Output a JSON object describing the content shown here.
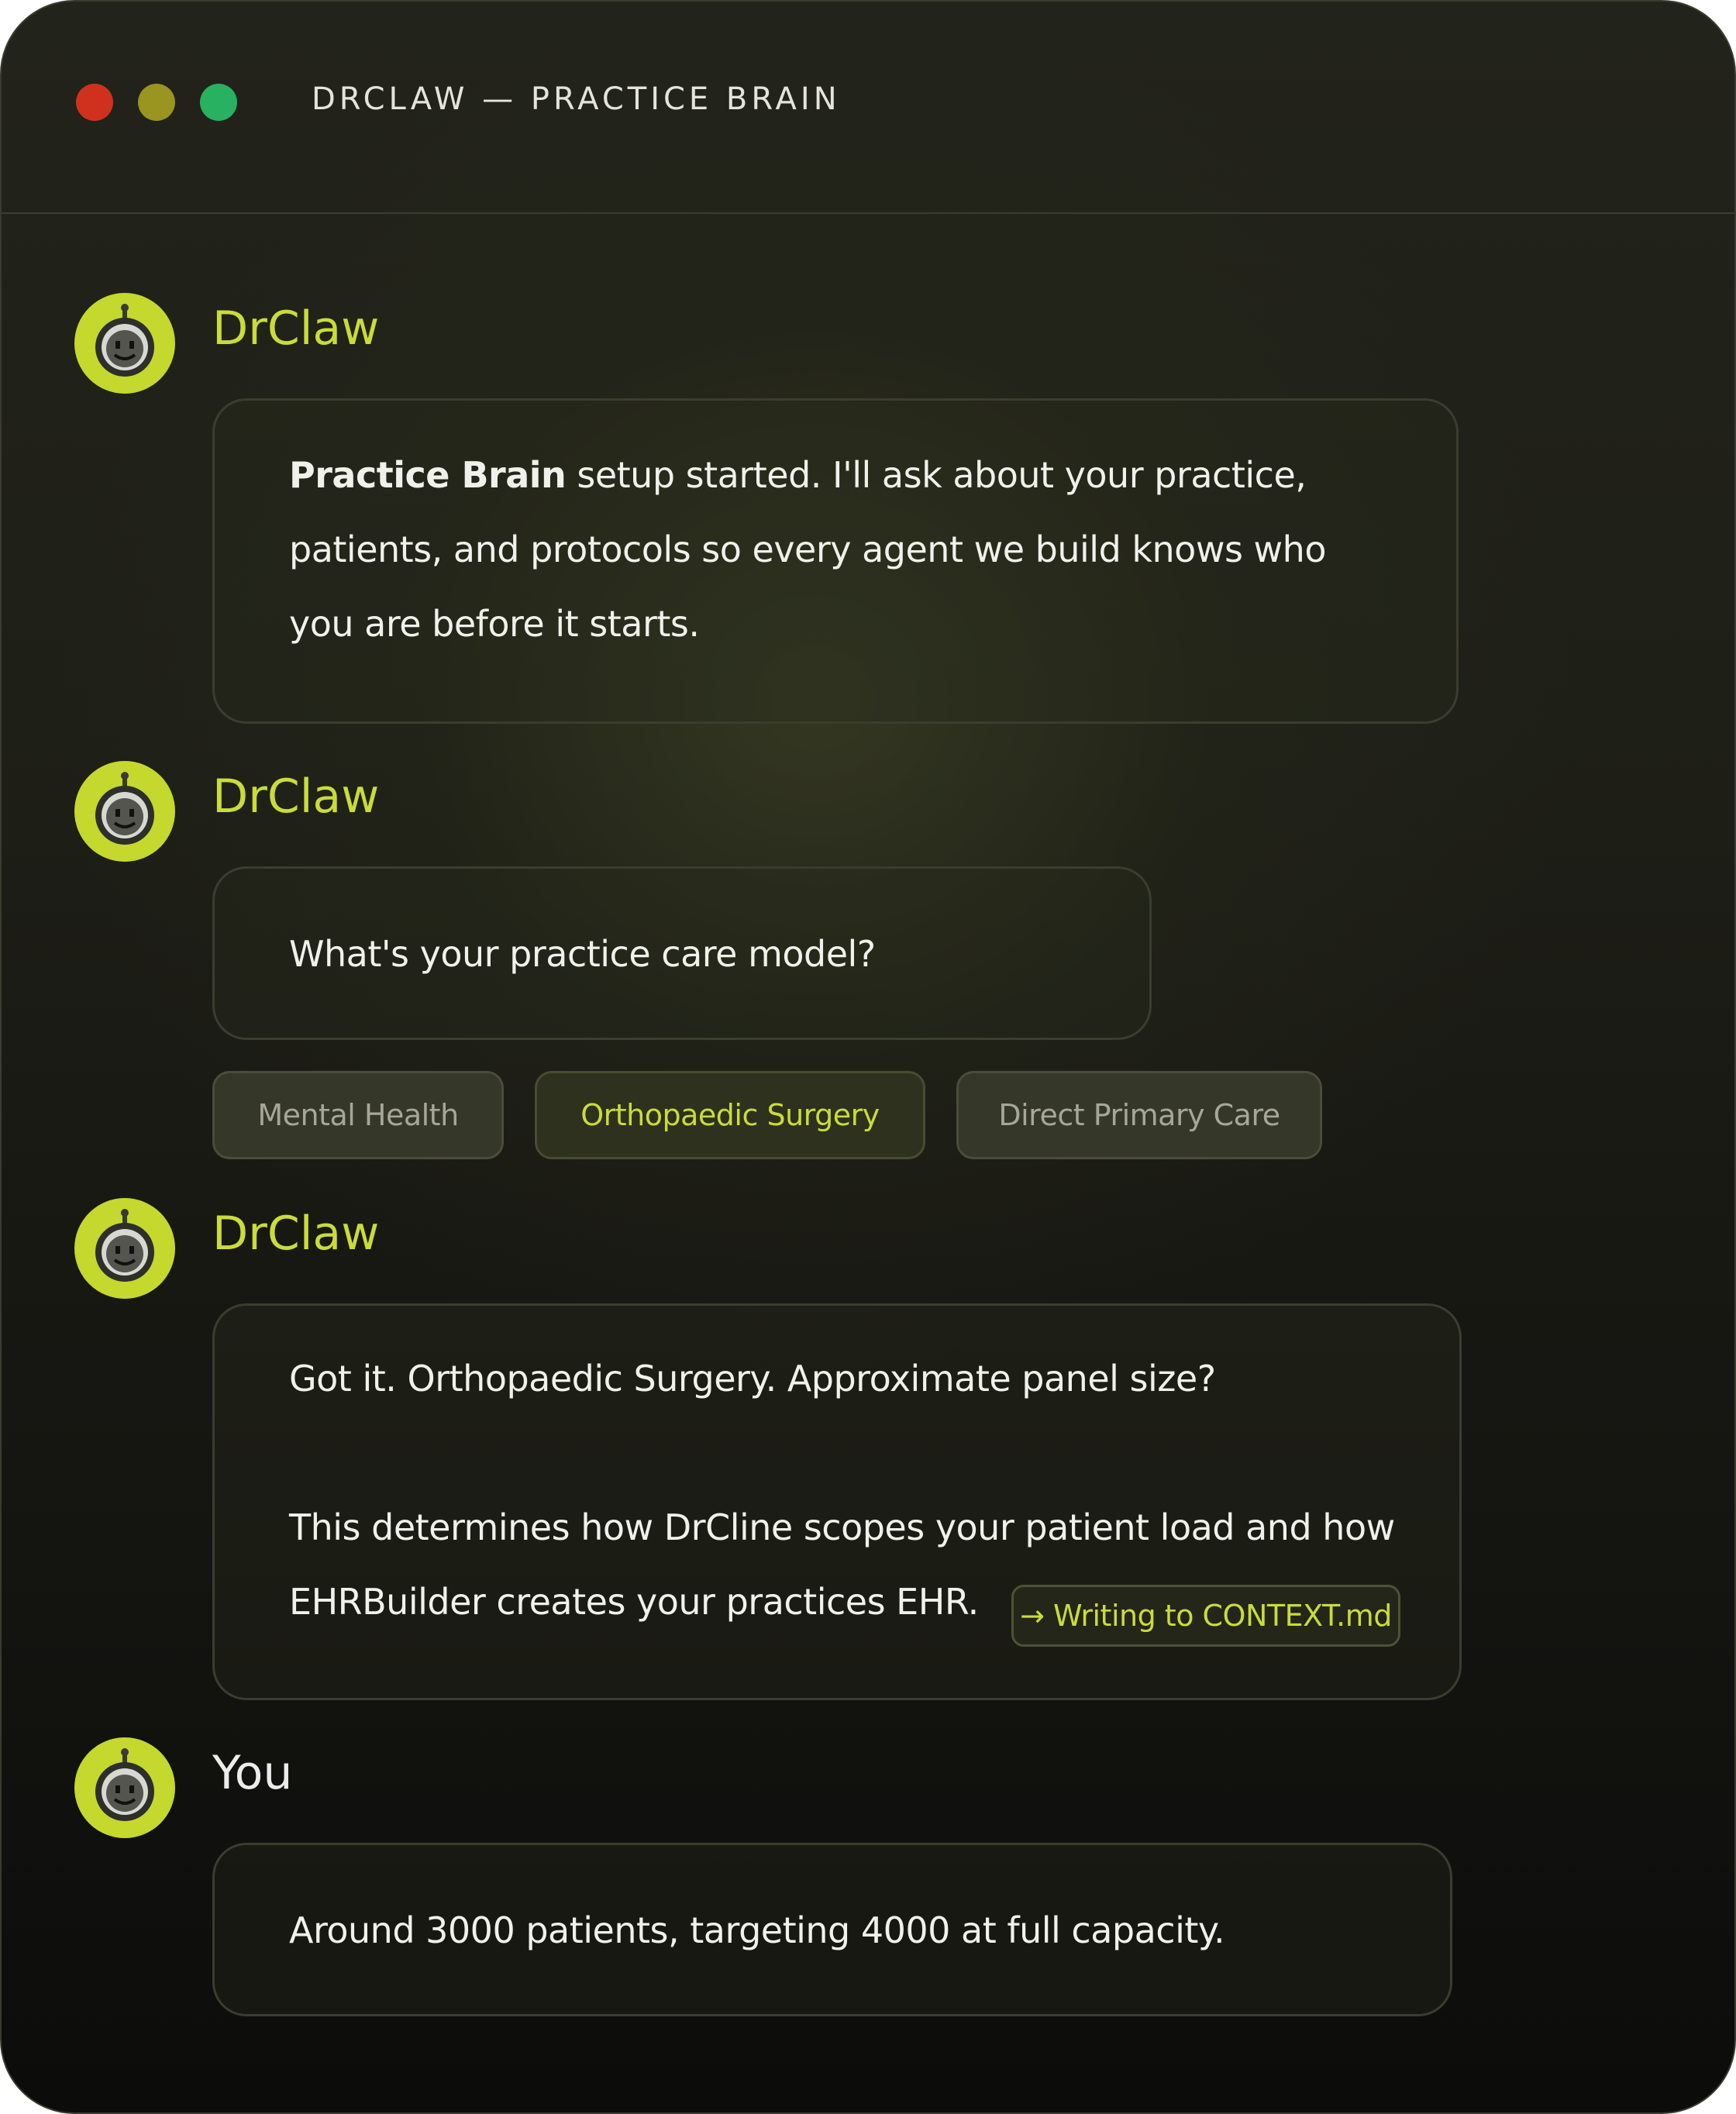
{
  "window": {
    "title": "DRCLAW — PRACTICE BRAIN"
  },
  "colors": {
    "accent": "#c9dc3a",
    "avatar_bg": "#c4d82e",
    "close": "#d0311f",
    "minimize": "#9a9420",
    "maximize": "#27b160"
  },
  "messages": [
    {
      "sender": "DrClaw",
      "text_bold": "Practice Brain",
      "text_line1": " setup started. I'll ask about your practice,",
      "text_line2": "patients, and protocols so every agent we build knows who",
      "text_line3": "you are before it starts."
    },
    {
      "sender": "DrClaw",
      "text": "What's your practice care model?",
      "options": [
        {
          "label": "Mental Health",
          "selected": false
        },
        {
          "label": "Orthopaedic Surgery",
          "selected": true
        },
        {
          "label": "Direct Primary Care",
          "selected": false
        }
      ]
    },
    {
      "sender": "DrClaw",
      "text_line1": "Got it. Orthopaedic Surgery. Approximate panel size?",
      "text_line2": "This determines how DrCline scopes your patient load and how",
      "text_line3": "EHRBuilder creates your practices EHR.",
      "tag": "→ Writing to CONTEXT.md"
    },
    {
      "sender": "You",
      "text": "Around 3000 patients, targeting 4000 at full capacity."
    }
  ],
  "icons": {
    "avatar": "robot-face-icon"
  }
}
